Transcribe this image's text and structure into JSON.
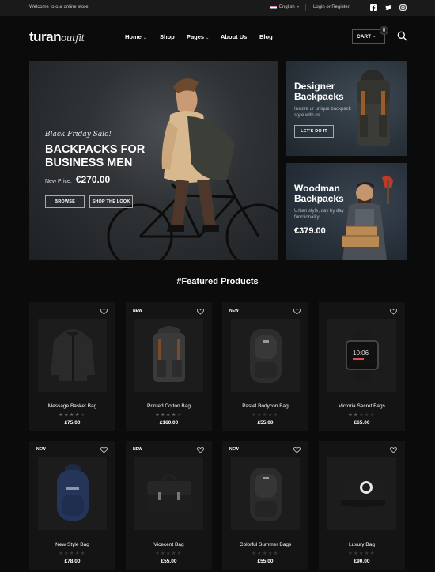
{
  "topbar": {
    "welcome": "Welcome to our online store!",
    "language": "English",
    "login": "Login or Register",
    "social_icons": [
      "facebook-icon",
      "twitter-icon",
      "instagram-icon"
    ]
  },
  "header": {
    "logo_main": "turan",
    "logo_script": "outfit",
    "nav": [
      "Home",
      "Shop",
      "Pages",
      "About Us",
      "Blog"
    ],
    "cart_label": "CART",
    "cart_count": "0"
  },
  "hero": {
    "tag": "Black Friday Sale!",
    "title_line1": "BACKPACKS FOR",
    "title_line2": "BUSINESS MEN",
    "price_label": "New Price:",
    "price": "€270.00",
    "browse": "BROWSE",
    "shop": "SHOP THE LOOK"
  },
  "promo1": {
    "title_line1": "Designer",
    "title_line2": "Backpacks",
    "text": "Inspire ur unique backpack style with us.",
    "button": "LET'S DO IT"
  },
  "promo2": {
    "title_line1": "Woodman",
    "title_line2": "Backpacks",
    "text": "Urban style, day by day functionality!",
    "price": "€379.00"
  },
  "featured": {
    "title": "#Featured Products",
    "products": [
      {
        "name": "Message Basket Bag",
        "price": "£75.00",
        "badge": ""
      },
      {
        "name": "Printed Cotton Bag",
        "price": "£160.00",
        "badge": "NEW"
      },
      {
        "name": "Pastel Bodycon Bag",
        "price": "£55.00",
        "badge": "NEW"
      },
      {
        "name": "Victoria Secret Bags",
        "price": "£65.00",
        "badge": ""
      },
      {
        "name": "New Style Bag",
        "price": "£78.00",
        "badge": "NEW"
      },
      {
        "name": "Vicecent Bag",
        "price": "£55.00",
        "badge": "NEW"
      },
      {
        "name": "Colorful Summer Bags",
        "price": "£55.00",
        "badge": "NEW"
      },
      {
        "name": "Luxury Bag",
        "price": "£90.00",
        "badge": ""
      }
    ],
    "ratings": [
      4,
      4,
      0,
      2,
      0,
      0,
      0,
      0
    ]
  }
}
